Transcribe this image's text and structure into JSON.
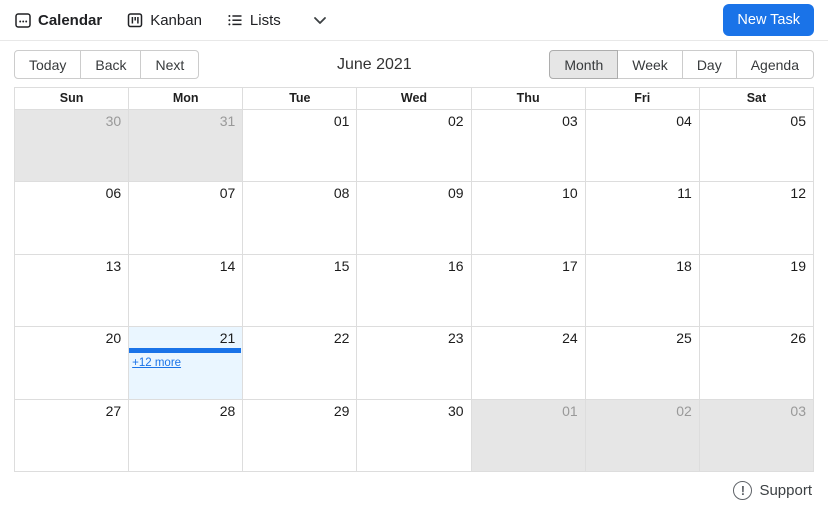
{
  "nav": {
    "items": [
      {
        "label": "Calendar",
        "icon": "calendar-icon",
        "active": true
      },
      {
        "label": "Kanban",
        "icon": "kanban-icon",
        "active": false
      },
      {
        "label": "Lists",
        "icon": "lists-icon",
        "active": false
      }
    ],
    "new_task_label": "New Task"
  },
  "toolbar": {
    "today_label": "Today",
    "back_label": "Back",
    "next_label": "Next",
    "title": "June 2021",
    "view_buttons": [
      "Month",
      "Week",
      "Day",
      "Agenda"
    ],
    "active_view": "Month"
  },
  "calendar": {
    "day_headers": [
      "Sun",
      "Mon",
      "Tue",
      "Wed",
      "Thu",
      "Fri",
      "Sat"
    ],
    "weeks": [
      [
        {
          "date": "30",
          "off_range": true
        },
        {
          "date": "31",
          "off_range": true
        },
        {
          "date": "01"
        },
        {
          "date": "02"
        },
        {
          "date": "03"
        },
        {
          "date": "04"
        },
        {
          "date": "05"
        }
      ],
      [
        {
          "date": "06"
        },
        {
          "date": "07"
        },
        {
          "date": "08"
        },
        {
          "date": "09"
        },
        {
          "date": "10"
        },
        {
          "date": "11"
        },
        {
          "date": "12"
        }
      ],
      [
        {
          "date": "13"
        },
        {
          "date": "14"
        },
        {
          "date": "15"
        },
        {
          "date": "16"
        },
        {
          "date": "17"
        },
        {
          "date": "18"
        },
        {
          "date": "19"
        }
      ],
      [
        {
          "date": "20"
        },
        {
          "date": "21",
          "today": true,
          "has_event_bar": true,
          "more_link": "+12 more"
        },
        {
          "date": "22"
        },
        {
          "date": "23"
        },
        {
          "date": "24"
        },
        {
          "date": "25"
        },
        {
          "date": "26"
        }
      ],
      [
        {
          "date": "27"
        },
        {
          "date": "28"
        },
        {
          "date": "29"
        },
        {
          "date": "30"
        },
        {
          "date": "01",
          "off_range": true
        },
        {
          "date": "02",
          "off_range": true
        },
        {
          "date": "03",
          "off_range": true
        }
      ]
    ]
  },
  "footer": {
    "support_label": "Support",
    "support_icon_glyph": "!"
  },
  "colors": {
    "accent_blue": "#1a73e8",
    "event_bar_blue": "#1a73e8",
    "link_blue": "#1a73e8",
    "today_cell_bg": "#eaf6ff",
    "off_range_bg": "#e6e6e6",
    "grid_border": "#dddddd",
    "active_view_bg": "#e6e6e6"
  }
}
